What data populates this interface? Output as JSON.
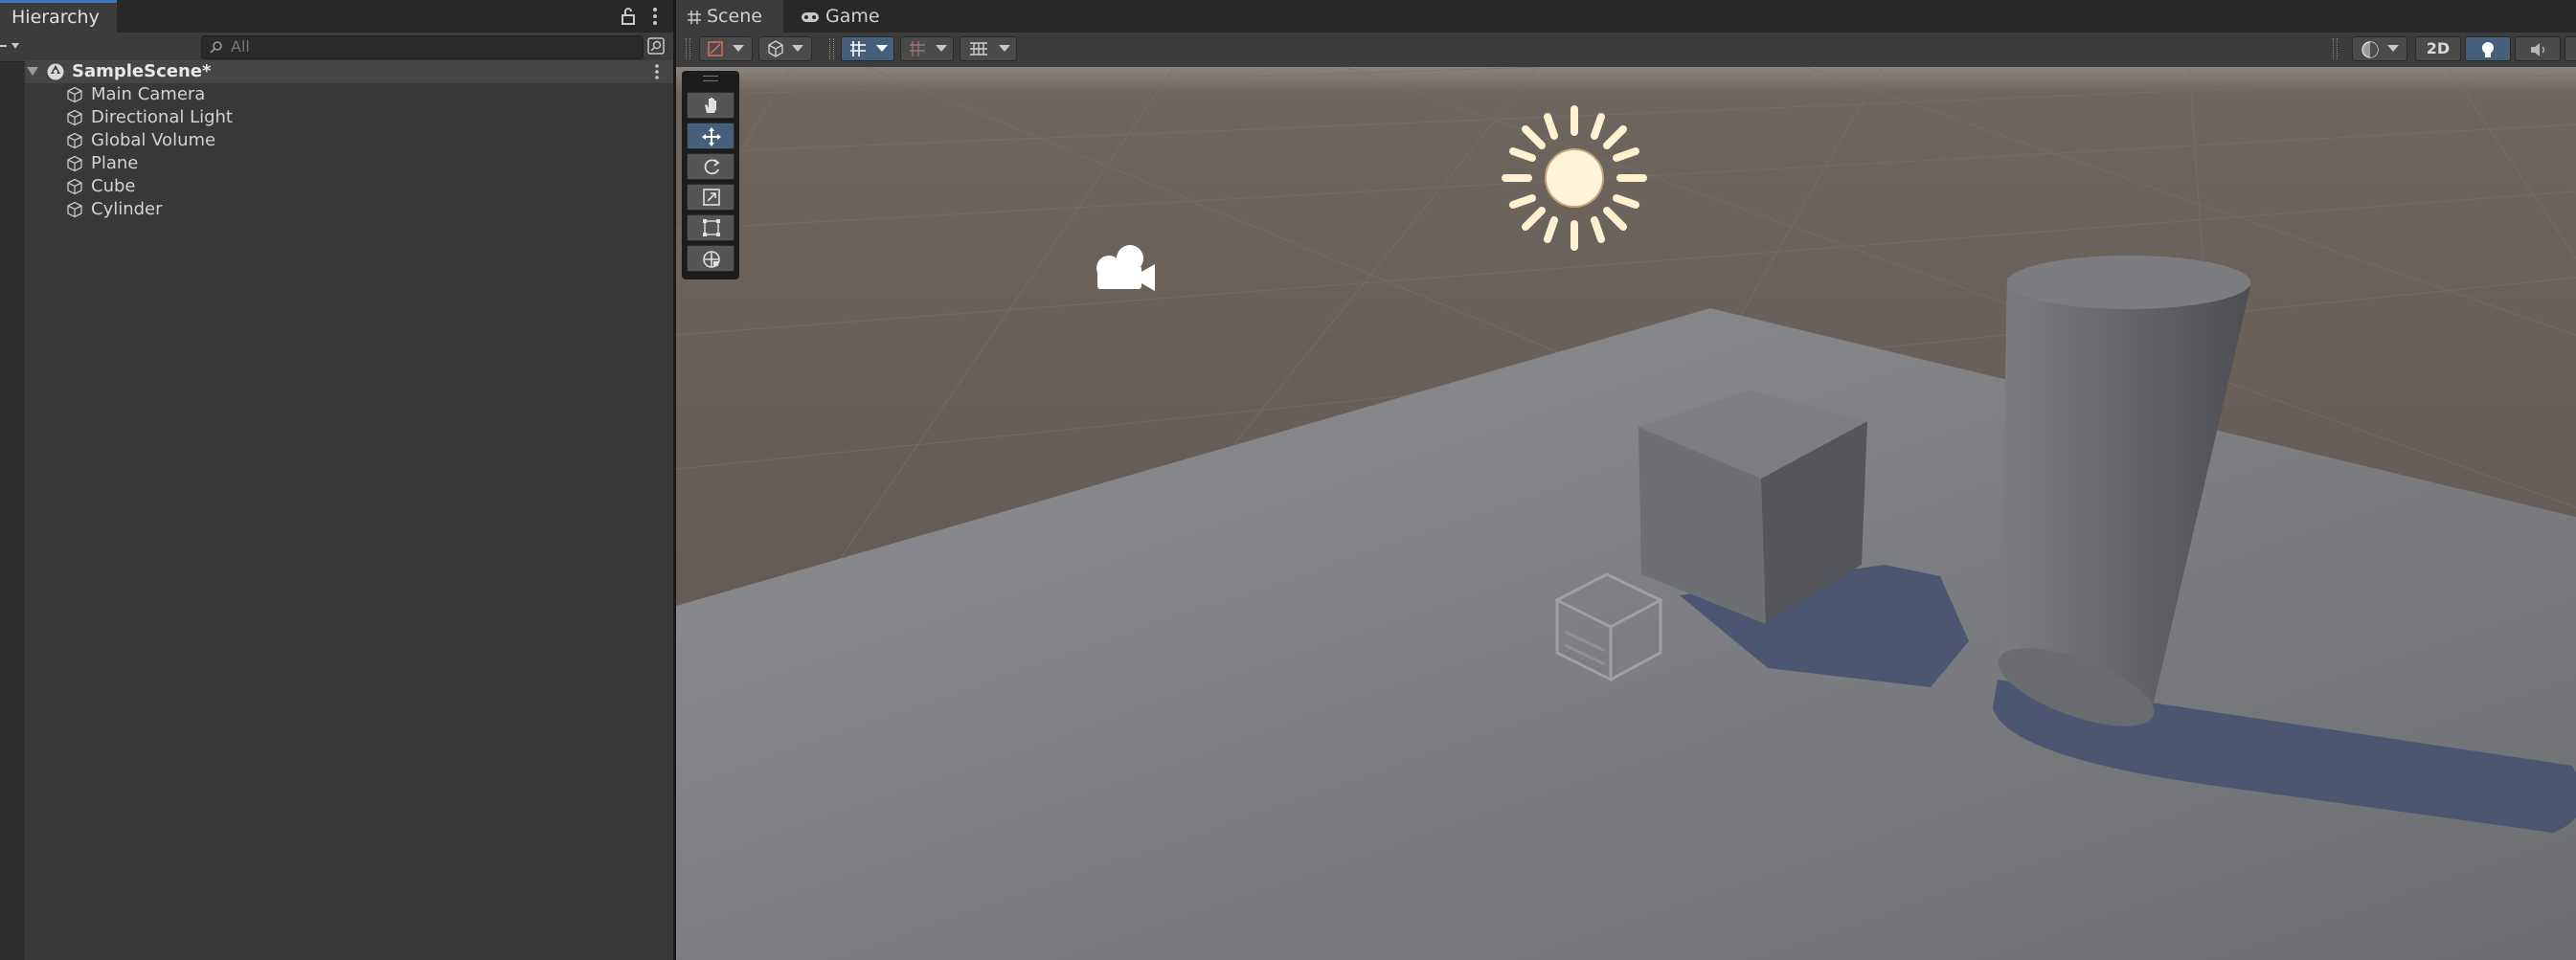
{
  "hierarchy": {
    "tab_label": "Hierarchy",
    "search_placeholder": "All",
    "scene_name": "SampleScene*",
    "objects": [
      "Main Camera",
      "Directional Light",
      "Global Volume",
      "Plane",
      "Cube",
      "Cylinder"
    ]
  },
  "scene_view": {
    "tabs": [
      "Scene",
      "Game"
    ],
    "toolbar": {
      "mode_2d_label": "2D"
    },
    "tools": [
      "hand-tool",
      "move-tool",
      "rotate-tool",
      "scale-tool",
      "rect-tool",
      "transform-tool"
    ],
    "active_tool": "move-tool"
  },
  "colors": {
    "accent": "#3a79bb",
    "toggle_on": "#46607c",
    "panel": "#383838",
    "ground": "#7d7d7d"
  }
}
